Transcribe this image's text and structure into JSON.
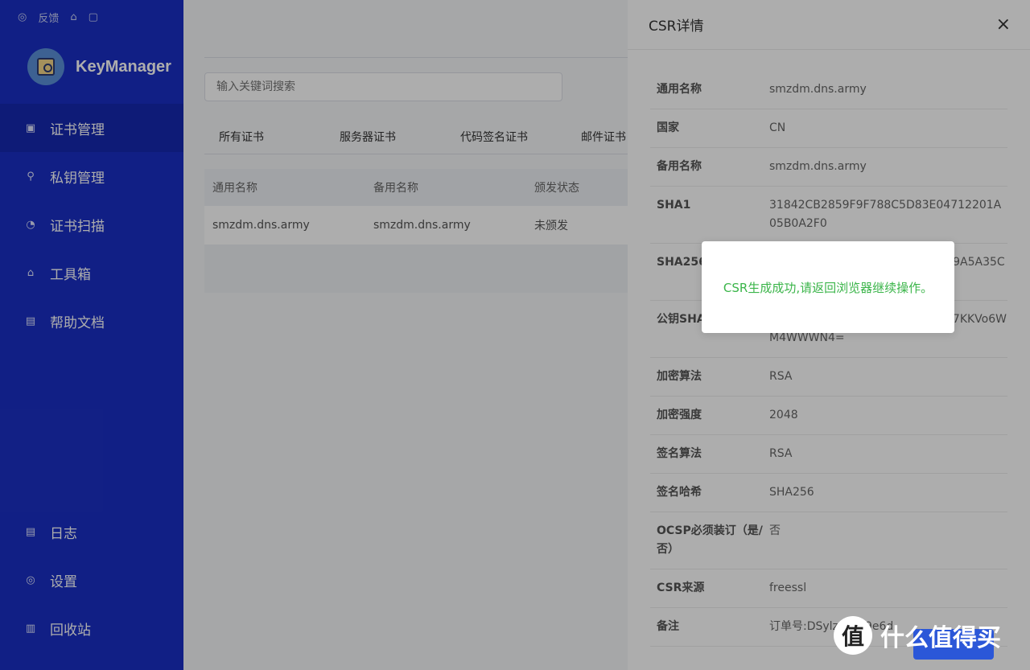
{
  "sidebar": {
    "top_icons": [
      {
        "icon": "target-icon",
        "label": ""
      },
      {
        "icon": "feedback-label",
        "label": "反馈"
      },
      {
        "icon": "shirt-icon",
        "label": ""
      },
      {
        "icon": "lock-icon",
        "label": ""
      }
    ],
    "brand": "KeyManager",
    "nav_main": [
      {
        "label": "证书管理",
        "icon": "certificate-icon"
      },
      {
        "label": "私钥管理",
        "icon": "key-icon"
      },
      {
        "label": "证书扫描",
        "icon": "scan-icon"
      },
      {
        "label": "工具箱",
        "icon": "toolbox-icon"
      },
      {
        "label": "帮助文档",
        "icon": "document-icon"
      }
    ],
    "nav_bottom": [
      {
        "label": "日志",
        "icon": "log-icon"
      },
      {
        "label": "设置",
        "icon": "settings-icon"
      },
      {
        "label": "回收站",
        "icon": "trash-icon"
      }
    ]
  },
  "main": {
    "search_placeholder": "输入关键词搜索",
    "tabs": [
      "所有证书",
      "服务器证书",
      "代码签名证书",
      "邮件证书"
    ],
    "table": {
      "headers": [
        "通用名称",
        "备用名称",
        "颁发状态"
      ],
      "rows": [
        [
          "smzdm.dns.army",
          "smzdm.dns.army",
          "未颁发"
        ]
      ]
    }
  },
  "drawer": {
    "title": "CSR详情",
    "close": "×",
    "fields": [
      {
        "k": "通用名称",
        "v": "smzdm.dns.army"
      },
      {
        "k": "国家",
        "v": "CN"
      },
      {
        "k": "备用名称",
        "v": "smzdm.dns.army"
      },
      {
        "k": "SHA1",
        "v": "31842CB2859F9F788C5D83E04712201A05B0A2F0"
      },
      {
        "k": "SHA256",
        "v": "0C801788DBCB78021751A65549A5A35C919E33704D1EA3659FA8BD61"
      },
      {
        "k": "公钥SHA256PIN",
        "v": "dHBLXXsOb10DSNZS2YJXI72Vsv7KKVo6WM4WWWN4="
      },
      {
        "k": "加密算法",
        "v": "RSA"
      },
      {
        "k": "加密强度",
        "v": "2048"
      },
      {
        "k": "签名算法",
        "v": "RSA"
      },
      {
        "k": "签名哈希",
        "v": "SHA256"
      },
      {
        "k": "OCSP必须装订（是/否）",
        "v": "否"
      },
      {
        "k": "CSR来源",
        "v": "freessl"
      },
      {
        "k": "备注",
        "v": "订单号:DSylzqYe69e6d"
      }
    ]
  },
  "toast": {
    "message": "CSR生成成功,请返回浏览器继续操作。"
  },
  "watermark": {
    "logo": "值",
    "text": "什么值得买"
  }
}
